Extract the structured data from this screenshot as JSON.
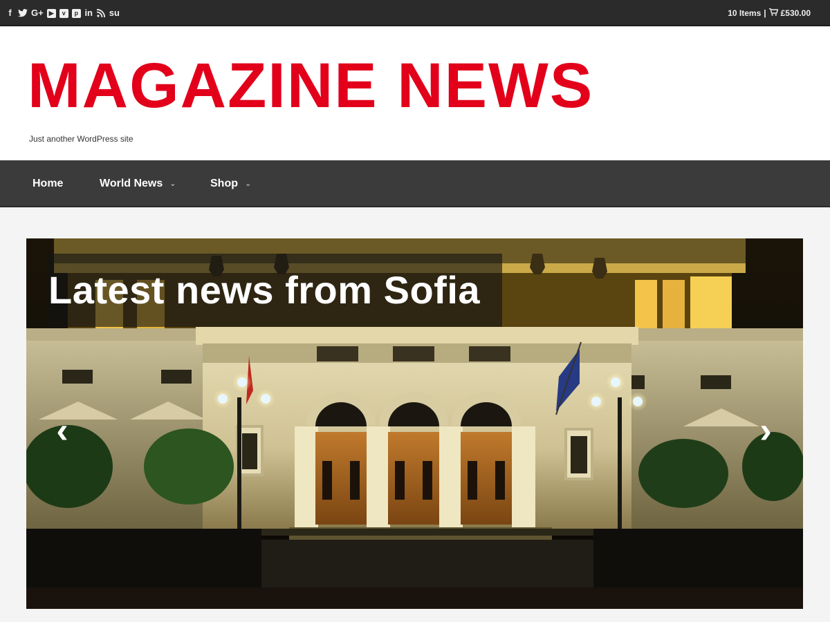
{
  "topbar": {
    "social_icons": [
      {
        "name": "facebook-icon",
        "glyph": "f"
      },
      {
        "name": "twitter-icon",
        "glyph": "t"
      },
      {
        "name": "google-plus-icon",
        "glyph": "G+"
      },
      {
        "name": "youtube-icon",
        "glyph": "▶"
      },
      {
        "name": "vimeo-icon",
        "glyph": "v"
      },
      {
        "name": "pinterest-icon",
        "glyph": "p"
      },
      {
        "name": "linkedin-icon",
        "glyph": "in"
      },
      {
        "name": "rss-icon",
        "glyph": "◝"
      },
      {
        "name": "stumbleupon-icon",
        "glyph": "su"
      }
    ],
    "cart_items": "10 Items",
    "cart_sep": "|",
    "cart_icon": "shopping-cart-icon",
    "cart_total": "£530.00"
  },
  "header": {
    "site_title": "MAGAZINE NEWS",
    "tagline": "Just another WordPress site",
    "title_color": "#e2001a"
  },
  "nav": {
    "items": [
      {
        "label": "Home"
      },
      {
        "label": "World News",
        "has_dropdown": true
      },
      {
        "label": "Shop",
        "has_dropdown": true
      }
    ],
    "chevron_icon": "chevron-down-icon"
  },
  "slider": {
    "caption": "Latest news from Sofia",
    "prev_icon": "chevron-left-icon",
    "next_icon": "chevron-right-icon"
  }
}
